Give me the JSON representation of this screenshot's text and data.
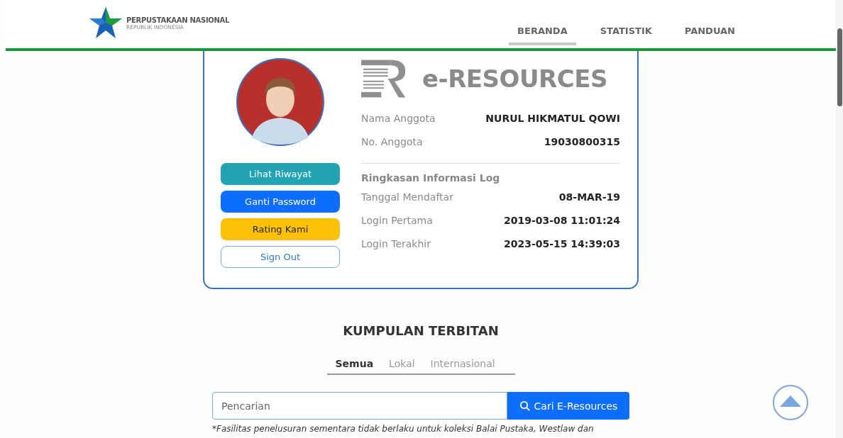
{
  "header": {
    "org_name": "PERPUSTAKAAN NASIONAL",
    "org_sub": "REPUBLIK INDONESIA",
    "nav": [
      {
        "label": "BERANDA",
        "selected": true
      },
      {
        "label": "STATISTIK",
        "selected": false
      },
      {
        "label": "PANDUAN",
        "selected": false
      }
    ]
  },
  "profile": {
    "brand": "e-RESOURCES",
    "buttons": [
      {
        "label": "Lihat Riwayat",
        "kind": "teal"
      },
      {
        "label": "Ganti Password",
        "kind": "primary"
      },
      {
        "label": "Rating Kami",
        "kind": "warning"
      },
      {
        "label": "Sign Out",
        "kind": "outline"
      }
    ],
    "member": [
      {
        "label": "Nama Anggota",
        "value": "NURUL HIKMATUL QOWI"
      },
      {
        "label": "No. Anggota",
        "value": "19030800315"
      }
    ],
    "log_title": "Ringkasan Informasi Log",
    "log": [
      {
        "label": "Tanggal Mendaftar",
        "value": "08-MAR-19"
      },
      {
        "label": "Login Pertama",
        "value": "2019-03-08 11:01:24"
      },
      {
        "label": "Login Terakhir",
        "value": "2023-05-15 14:39:03"
      }
    ]
  },
  "collection": {
    "title": "KUMPULAN TERBITAN",
    "tabs": [
      {
        "label": "Semua",
        "selected": true
      },
      {
        "label": "Lokal",
        "selected": false
      },
      {
        "label": "Internasional",
        "selected": false
      }
    ],
    "search": {
      "placeholder": "Pencarian",
      "button": "Cari E-Resources"
    },
    "note": "*Fasilitas penelusuran sementara tidak berlaku untuk koleksi Balai Pustaka, Westlaw dan"
  }
}
